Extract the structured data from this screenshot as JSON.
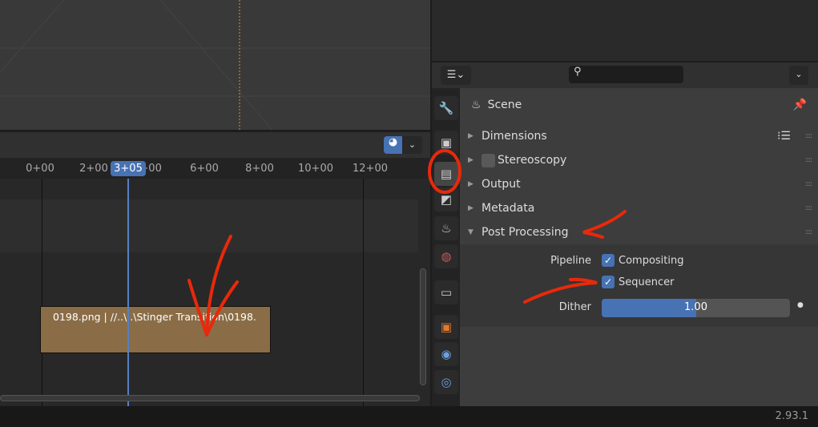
{
  "timeline": {
    "ticks": [
      "0+00",
      "2+00",
      "4+00",
      "6+00",
      "8+00",
      "10+00",
      "12+00"
    ],
    "current_frame": "3+05"
  },
  "strip": {
    "label": "0198.png | //..\\..\\Stinger Transition\\0198.",
    "color": "#8a6d47"
  },
  "properties": {
    "context": "Scene",
    "panels": [
      {
        "label": "Dimensions",
        "open": false
      },
      {
        "label": "Stereoscopy",
        "open": false,
        "checkbox": false
      },
      {
        "label": "Output",
        "open": false
      },
      {
        "label": "Metadata",
        "open": false
      },
      {
        "label": "Post Processing",
        "open": true
      }
    ],
    "pipeline_label": "Pipeline",
    "compositing": {
      "label": "Compositing",
      "checked": true
    },
    "sequencer": {
      "label": "Sequencer",
      "checked": true
    },
    "dither": {
      "label": "Dither",
      "value": "1.00",
      "fraction": 0.5
    }
  },
  "version": "2.93.1",
  "accent": "#4772b3"
}
